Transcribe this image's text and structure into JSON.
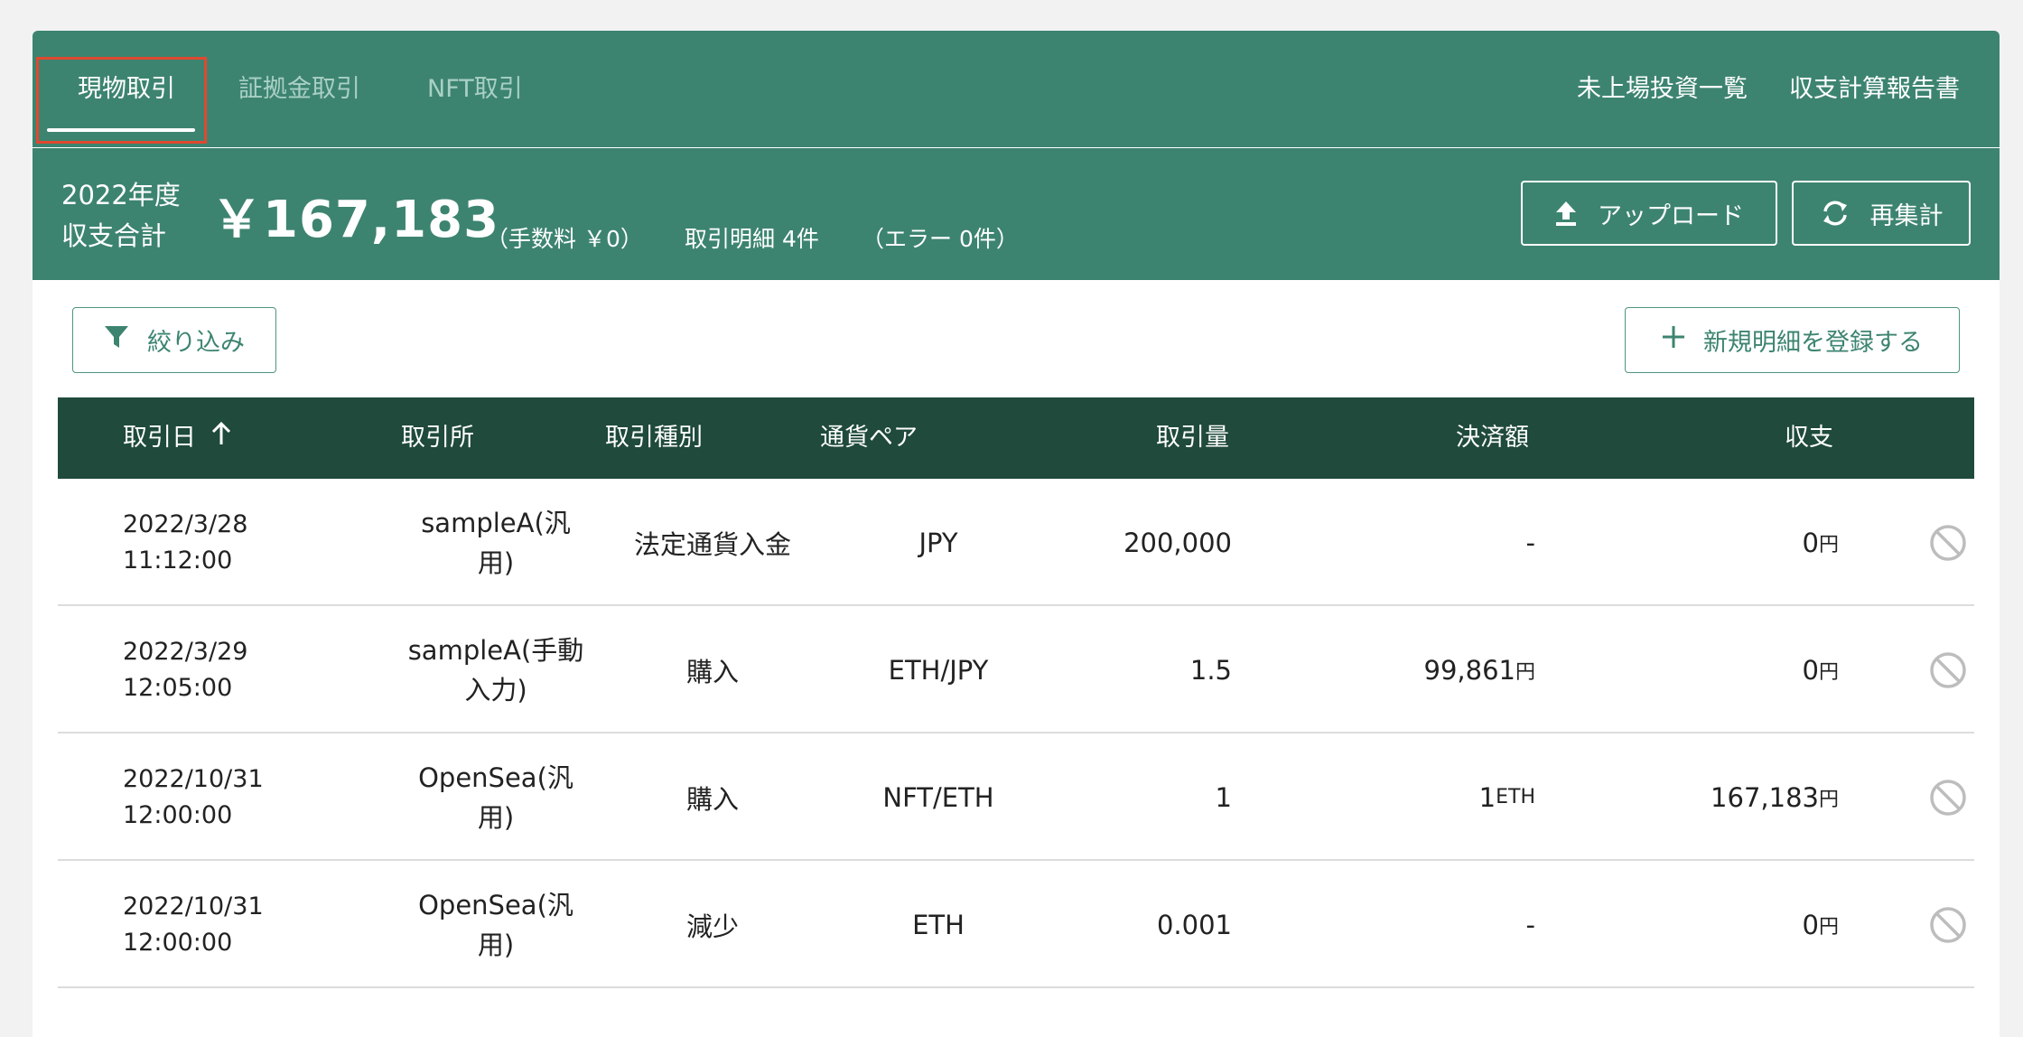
{
  "tabs": [
    {
      "label": "現物取引",
      "active": true
    },
    {
      "label": "証拠金取引",
      "active": false
    },
    {
      "label": "NFT取引",
      "active": false
    }
  ],
  "top_links": [
    "未上場投資一覧",
    "収支計算報告書"
  ],
  "summary": {
    "year_line1": "2022年度",
    "year_line2": "収支合計",
    "total": "￥167,183",
    "fee": "（手数料 ￥0）",
    "detail_count": "取引明細 4件",
    "error_count": "（エラー 0件）"
  },
  "header_buttons": {
    "upload": "アップロード",
    "recalc": "再集計"
  },
  "toolbar": {
    "filter": "絞り込み",
    "new_entry": "新規明細を登録する"
  },
  "table": {
    "columns": [
      "取引日",
      "取引所",
      "取引種別",
      "通貨ペア",
      "取引量",
      "決済額",
      "収支"
    ],
    "rows": [
      {
        "date1": "2022/3/28",
        "date2": "11:12:00",
        "exch1": "sampleA(汎",
        "exch2": "用)",
        "kind": "法定通貨入金",
        "pair": "JPY",
        "qty": "200,000",
        "settle": "-",
        "settle_unit": "",
        "pl": "0",
        "pl_unit": "円"
      },
      {
        "date1": "2022/3/29",
        "date2": "12:05:00",
        "exch1": "sampleA(手動",
        "exch2": "入力)",
        "kind": "購入",
        "pair": "ETH/JPY",
        "qty": "1.5",
        "settle": "99,861",
        "settle_unit": "円",
        "pl": "0",
        "pl_unit": "円"
      },
      {
        "date1": "2022/10/31",
        "date2": "12:00:00",
        "exch1": "OpenSea(汎",
        "exch2": "用)",
        "kind": "購入",
        "pair": "NFT/ETH",
        "qty": "1",
        "settle": "1",
        "settle_unit": "ETH",
        "pl": "167,183",
        "pl_unit": "円"
      },
      {
        "date1": "2022/10/31",
        "date2": "12:00:00",
        "exch1": "OpenSea(汎",
        "exch2": "用)",
        "kind": "減少",
        "pair": "ETH",
        "qty": "0.001",
        "settle": "-",
        "settle_unit": "",
        "pl": "0",
        "pl_unit": "円"
      }
    ]
  },
  "colors": {
    "header_green": "#3d8470",
    "table_head": "#1f4a3c",
    "highlight_red": "#e0482f"
  }
}
